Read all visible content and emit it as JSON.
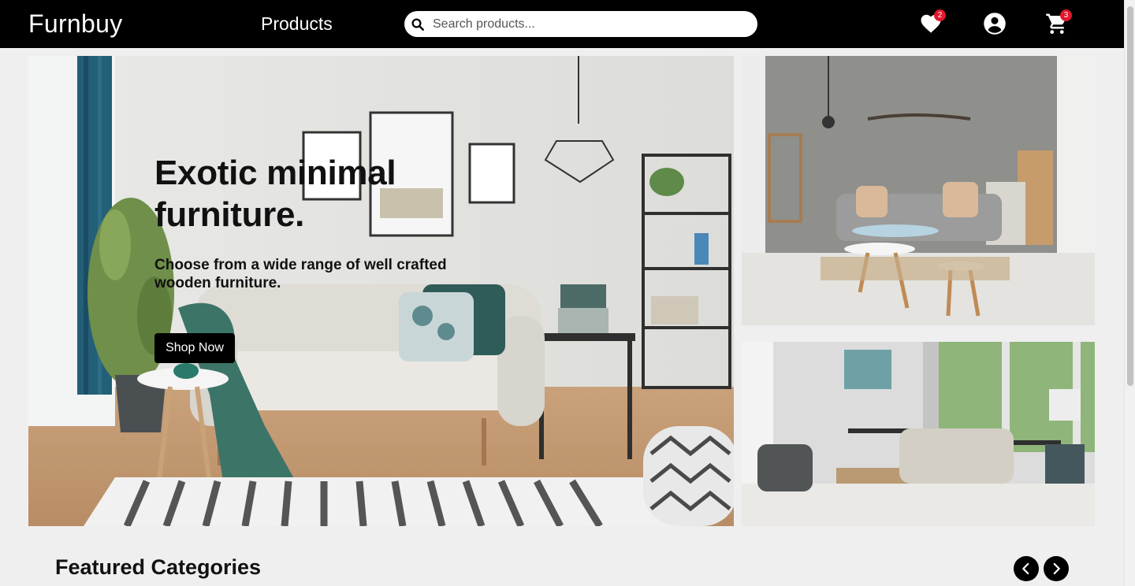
{
  "navbar": {
    "brand": "Furnbuy",
    "products_link": "Products",
    "search_placeholder": "Search products...",
    "wishlist_count": "2",
    "cart_count": "3"
  },
  "hero": {
    "title": "Exotic minimal furniture.",
    "subtitle": "Choose from a wide range of well crafted wooden furniture.",
    "cta_label": "Shop Now"
  },
  "featured": {
    "title": "Featured Categories"
  },
  "colors": {
    "navbar_bg": "#000000",
    "badge": "#e0182d",
    "accent_teal": "#3f7b72"
  }
}
